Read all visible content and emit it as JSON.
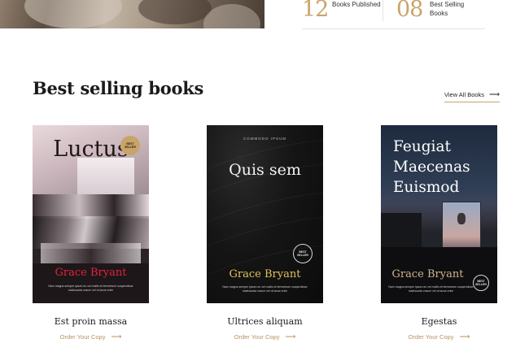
{
  "stats": [
    {
      "number": "12",
      "label": "Books Published"
    },
    {
      "number": "08",
      "label": "Best Selling Books"
    }
  ],
  "section": {
    "title": "Best selling books",
    "view_all_label": "View All Books"
  },
  "books": [
    {
      "cover_title": "Luctus",
      "cover_kicker": "",
      "author": "Grace Bryant",
      "blurb": "Nam magna semper ipsum eu vel mollis et fermentum suspendisse malesuada vosum vel ut lacus enim",
      "badge": "BEST SELLER",
      "card_title": "Est proin massa",
      "order_label": "Order Your Copy"
    },
    {
      "cover_title": "Quis sem",
      "cover_kicker": "COMMODO IPSUM",
      "author": "Grace Bryant",
      "blurb": "Nam magna semper ipsum eu vel mollis et fermentum suspendisse malesuada vosum vel ut lacus enim",
      "badge": "BEST SELLER",
      "card_title": "Ultrices aliquam",
      "order_label": "Order Your Copy"
    },
    {
      "cover_title_lines": [
        "Feugiat",
        "Maecenas",
        "Euismod"
      ],
      "author": "Grace Bryant",
      "blurb": "Nam magna semper ipsum eu vel mollis et fermentum suspendisse malesuada vosum vel ut lacus enim",
      "badge": "BEST SELLER",
      "card_title": "Egestas",
      "order_label": "Order Your Copy"
    }
  ],
  "colors": {
    "accent_gold": "#c8a46a",
    "order_link": "#b8935c",
    "author_red": "#e0243c",
    "author_gold": "#e2c25a"
  }
}
